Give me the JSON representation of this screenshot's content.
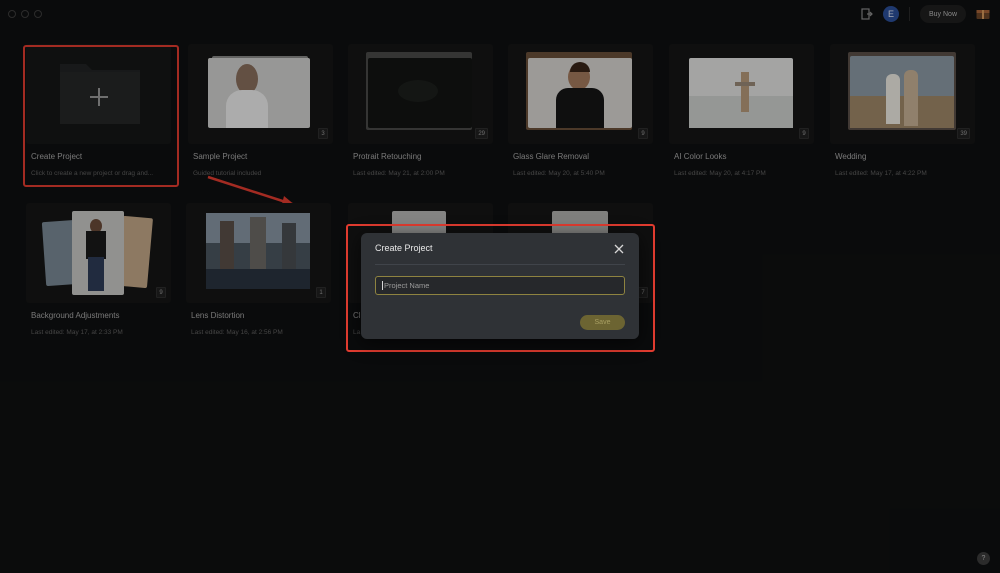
{
  "titlebar": {
    "buy_label": "Buy Now",
    "avatar_initial": "E"
  },
  "create_card": {
    "title": "Create Project",
    "subtitle": "Click to create a new project or drag and..."
  },
  "projects": [
    {
      "title": "Sample Project",
      "subtitle": "Guided tutorial included",
      "count": "3"
    },
    {
      "title": "Protrait Retouching",
      "subtitle": "Last edited: May 21, at 2:00 PM",
      "count": "29"
    },
    {
      "title": "Glass Glare Removal",
      "subtitle": "Last edited: May 20, at 5:40 PM",
      "count": "9"
    },
    {
      "title": "AI Color Looks",
      "subtitle": "Last edited: May 20, at 4:17 PM",
      "count": "9"
    },
    {
      "title": "Wedding",
      "subtitle": "Last edited: May 17, at 4:22 PM",
      "count": "39"
    },
    {
      "title": "Background Adjustments",
      "subtitle": "Last edited: May 17, at 2:33 PM",
      "count": "9"
    },
    {
      "title": "Lens Distortion",
      "subtitle": "Last edited: May 16, at 2:56 PM",
      "count": "1"
    },
    {
      "title": "Cl",
      "subtitle": "La",
      "count": ""
    },
    {
      "title": "",
      "subtitle": "",
      "count": "7"
    }
  ],
  "dialog": {
    "title": "Create Project",
    "placeholder": "Project Name",
    "save_label": "Save"
  },
  "help_label": "?",
  "colors": {
    "annotation": "#e23c30",
    "accent": "#8e8340",
    "avatar": "#2c4f9a"
  }
}
